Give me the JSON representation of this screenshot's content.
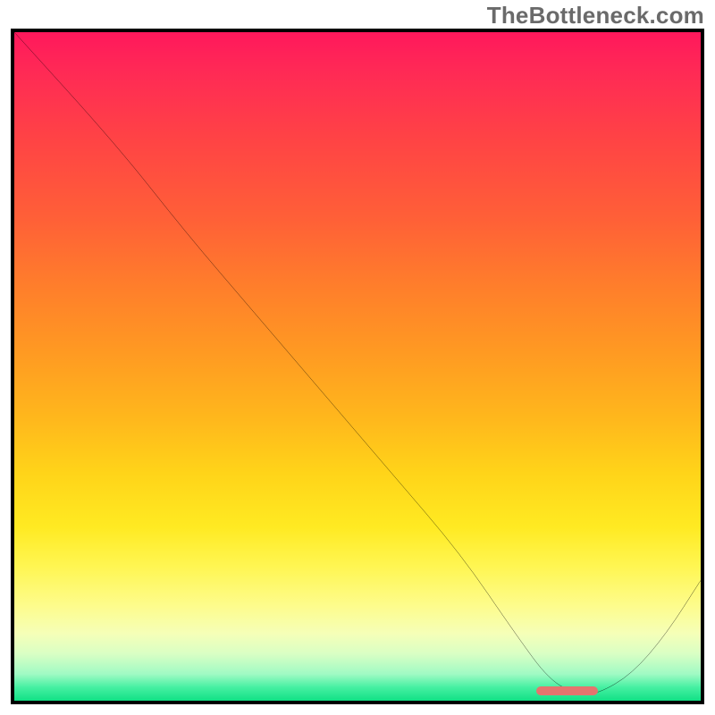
{
  "watermark": "TheBottleneck.com",
  "chart_data": {
    "type": "line",
    "title": "",
    "xlabel": "",
    "ylabel": "",
    "xlim": [
      0,
      100
    ],
    "ylim": [
      0,
      100
    ],
    "x": [
      0,
      15,
      25,
      35,
      45,
      55,
      65,
      73,
      78,
      82,
      85,
      90,
      95,
      100
    ],
    "values": [
      100,
      83,
      70,
      58,
      46,
      34,
      22,
      10,
      3,
      1,
      1,
      4,
      10,
      18
    ],
    "marker": {
      "x_start": 76,
      "x_end": 85,
      "y": 0.8
    },
    "grid": false,
    "legend": false
  },
  "colors": {
    "curve": "#000000",
    "border": "#000000",
    "marker": "#e4756e"
  }
}
